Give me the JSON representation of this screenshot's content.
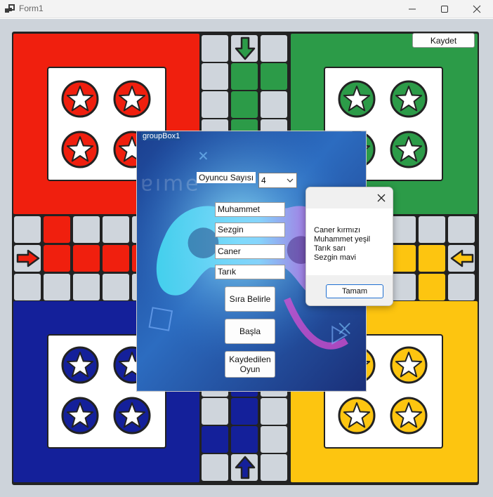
{
  "window": {
    "title": "Form1",
    "controls": [
      "minimize",
      "maximize",
      "close"
    ]
  },
  "toolbar": {
    "save_label": "Kaydet"
  },
  "board": {
    "colors": {
      "red": "#f01f0e",
      "green": "#2c9b48",
      "blue": "#14209a",
      "yellow": "#fdc510",
      "grey_cell": "#cfd5dc",
      "outline": "#222222"
    },
    "arrows": [
      "down-arrow",
      "left-arrow",
      "right-arrow",
      "up-arrow"
    ],
    "token_icon": "star-token-icon"
  },
  "groupbox": {
    "title": "groupBox1",
    "player_count_label": "Oyuncu Sayısı",
    "player_count_value": "4",
    "players": [
      "Muhammet",
      "Sezgin",
      "Caner",
      "Tarık"
    ],
    "buttons": {
      "determine_order": "Sıra Belirle",
      "start": "Başla",
      "saved_game": "Kaydedilen Oyun"
    }
  },
  "message_box": {
    "lines": [
      "Caner kırmızı",
      "Muhammet yeşil",
      "Tarık sarı",
      "Sezgin mavi"
    ],
    "ok_label": "Tamam"
  }
}
